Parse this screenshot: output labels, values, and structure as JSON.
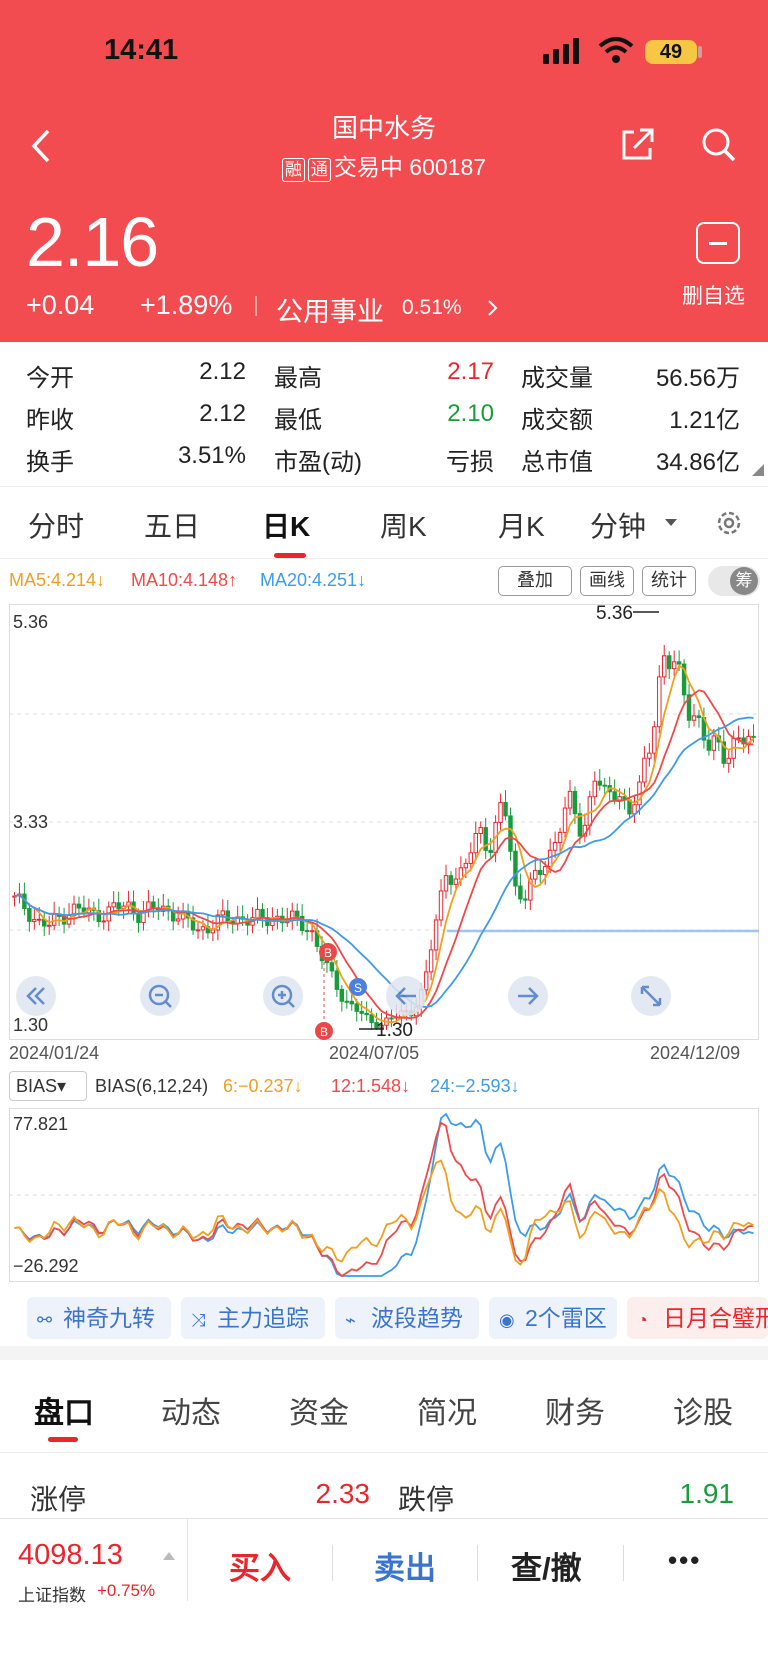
{
  "status": {
    "time": "14:41",
    "battery": "49"
  },
  "header": {
    "title": "国中水务",
    "tags": [
      "融",
      "通"
    ],
    "subtitle": "交易中 600187",
    "price": "2.16",
    "change": "+0.04",
    "change_pct": "+1.89%",
    "sector": "公用事业",
    "sector_pct": "0.51%",
    "delete_label": "删自选"
  },
  "stats": {
    "open_label": "今开",
    "open": "2.12",
    "high_label": "最高",
    "high": "2.17",
    "volume_label": "成交量",
    "volume": "56.56万",
    "prev_label": "昨收",
    "prev": "2.12",
    "low_label": "最低",
    "low": "2.10",
    "amount_label": "成交额",
    "amount": "1.21亿",
    "turnover_label": "换手",
    "turnover": "3.51%",
    "pe_label": "市盈(动)",
    "pe": "亏损",
    "mcap_label": "总市值",
    "mcap": "34.86亿"
  },
  "chart_tabs": [
    "分时",
    "五日",
    "日K",
    "周K",
    "月K",
    "分钟"
  ],
  "ma": {
    "ma5": "MA5:4.214↓",
    "ma10": "MA10:4.148↑",
    "ma20": "MA20:4.251↓"
  },
  "tools": [
    "叠加",
    "画线",
    "统计"
  ],
  "toggle_label": "筹",
  "colors": {
    "header": "#f24c50",
    "up": "#e8262d",
    "down": "#1a9b3c",
    "ma5": "#f0a020",
    "ma10": "#ef4a4a",
    "ma20": "#3d9be9",
    "accent": "#3b74cc"
  },
  "chart_data": {
    "type": "candlestick",
    "x_labels": [
      "2024/01/24",
      "2024/07/05",
      "2024/12/09"
    ],
    "ylim": [
      1.3,
      5.36
    ],
    "y_ticks": [
      "5.36",
      "3.33",
      "1.30"
    ],
    "high_annotation": "5.36",
    "low_annotation": "1.30",
    "markers": [
      "B",
      "S",
      "B"
    ],
    "close_path": [
      2.55,
      2.5,
      2.35,
      2.3,
      2.4,
      2.48,
      2.45,
      2.42,
      2.45,
      2.48,
      2.5,
      2.44,
      2.46,
      2.48,
      2.45,
      2.35,
      2.28,
      2.3,
      2.36,
      2.38,
      2.4,
      2.36,
      2.38,
      2.4,
      2.37,
      2.35,
      2.3,
      2.0,
      1.8,
      1.6,
      1.5,
      1.4,
      1.35,
      1.4,
      1.45,
      1.5,
      1.7,
      2.3,
      2.9,
      2.7,
      3.0,
      3.3,
      3.0,
      3.6,
      2.7,
      2.6,
      2.8,
      3.0,
      3.3,
      3.5,
      3.2,
      3.8,
      3.5,
      3.7,
      3.4,
      3.6,
      4.2,
      4.9,
      4.8,
      4.6,
      4.3,
      4.0,
      4.1,
      4.0,
      4.1,
      4.1
    ],
    "bias": {
      "label": "BIAS(6,12,24)",
      "b6": "6:−0.237↓",
      "b12": "12:1.548↓",
      "b24": "24:−2.593↓",
      "ymax": "77.821",
      "ymin": "−26.292"
    }
  },
  "bias_selector": "BIAS▾",
  "features": [
    "神奇九转",
    "主力追踪",
    "波段趋势",
    "2个雷区",
    "日月合璧形"
  ],
  "bottom_tabs": [
    "盘口",
    "动态",
    "资金",
    "简况",
    "财务",
    "诊股"
  ],
  "limits": {
    "up_label": "涨停",
    "up": "2.33",
    "down_label": "跌停",
    "down": "1.91"
  },
  "index": {
    "value": "4098.13",
    "name": "上证指数",
    "pct": "+0.75%"
  },
  "actions": {
    "buy": "买入",
    "sell": "卖出",
    "query": "查/撤",
    "more": "•••"
  }
}
